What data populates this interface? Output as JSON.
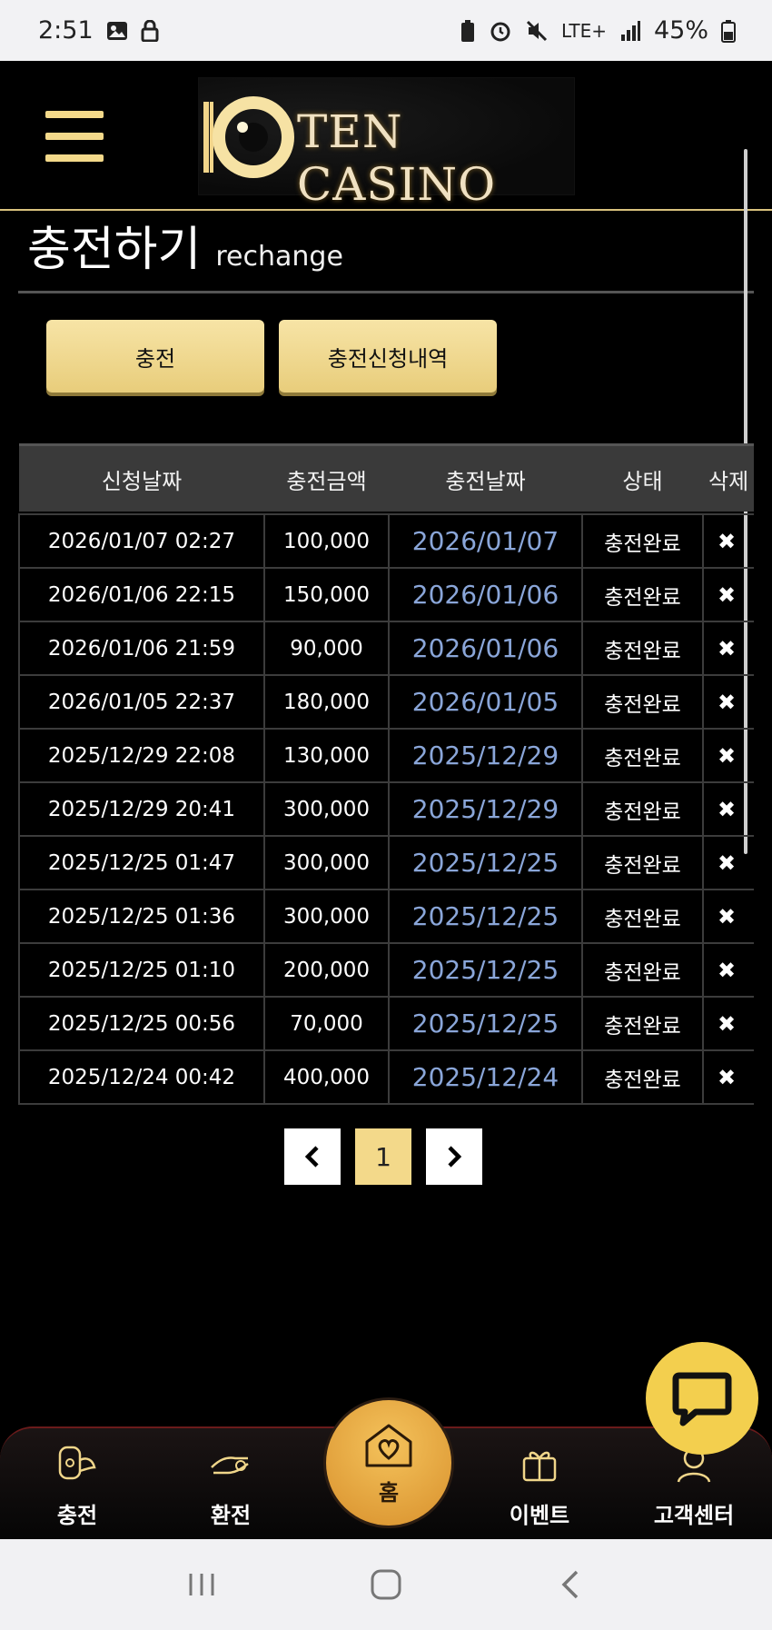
{
  "status_bar": {
    "time": "2:51",
    "network": "LTE+",
    "battery": "45%"
  },
  "header": {
    "logo_text": "TEN CASINO"
  },
  "title": {
    "main": "충전하기",
    "sub": "rechange"
  },
  "buttons": {
    "charge": "충전",
    "history": "충전신청내역"
  },
  "table": {
    "headers": [
      "신청날짜",
      "충전금액",
      "충전날짜",
      "상태",
      "삭제"
    ],
    "rows": [
      {
        "request": "2026/01/07 02:27",
        "amount": "100,000",
        "date": "2026/01/07",
        "status": "충전완료",
        "delete": "✖"
      },
      {
        "request": "2026/01/06 22:15",
        "amount": "150,000",
        "date": "2026/01/06",
        "status": "충전완료",
        "delete": "✖"
      },
      {
        "request": "2026/01/06 21:59",
        "amount": "90,000",
        "date": "2026/01/06",
        "status": "충전완료",
        "delete": "✖"
      },
      {
        "request": "2026/01/05 22:37",
        "amount": "180,000",
        "date": "2026/01/05",
        "status": "충전완료",
        "delete": "✖"
      },
      {
        "request": "2025/12/29 22:08",
        "amount": "130,000",
        "date": "2025/12/29",
        "status": "충전완료",
        "delete": "✖"
      },
      {
        "request": "2025/12/29 20:41",
        "amount": "300,000",
        "date": "2025/12/29",
        "status": "충전완료",
        "delete": "✖"
      },
      {
        "request": "2025/12/25 01:47",
        "amount": "300,000",
        "date": "2025/12/25",
        "status": "충전완료",
        "delete": "✖"
      },
      {
        "request": "2025/12/25 01:36",
        "amount": "300,000",
        "date": "2025/12/25",
        "status": "충전완료",
        "delete": "✖"
      },
      {
        "request": "2025/12/25 01:10",
        "amount": "200,000",
        "date": "2025/12/25",
        "status": "충전완료",
        "delete": "✖"
      },
      {
        "request": "2025/12/25 00:56",
        "amount": "70,000",
        "date": "2025/12/25",
        "status": "충전완료",
        "delete": "✖"
      },
      {
        "request": "2025/12/24 00:42",
        "amount": "400,000",
        "date": "2025/12/24",
        "status": "충전완료",
        "delete": "✖"
      }
    ]
  },
  "pagination": {
    "prev": "‹",
    "current": "1",
    "next": "›"
  },
  "bottom_nav": {
    "items": [
      {
        "label": "충전",
        "icon": "charge-icon"
      },
      {
        "label": "환전",
        "icon": "exchange-icon"
      },
      {
        "label": "홈",
        "icon": "home-heart-icon"
      },
      {
        "label": "이벤트",
        "icon": "gift-icon"
      },
      {
        "label": "고객센터",
        "icon": "support-icon"
      }
    ]
  },
  "colors": {
    "accent": "#f3d98a",
    "link": "#8aa6d9",
    "chat": "#f3cf4e",
    "home": "#e6a43d"
  }
}
